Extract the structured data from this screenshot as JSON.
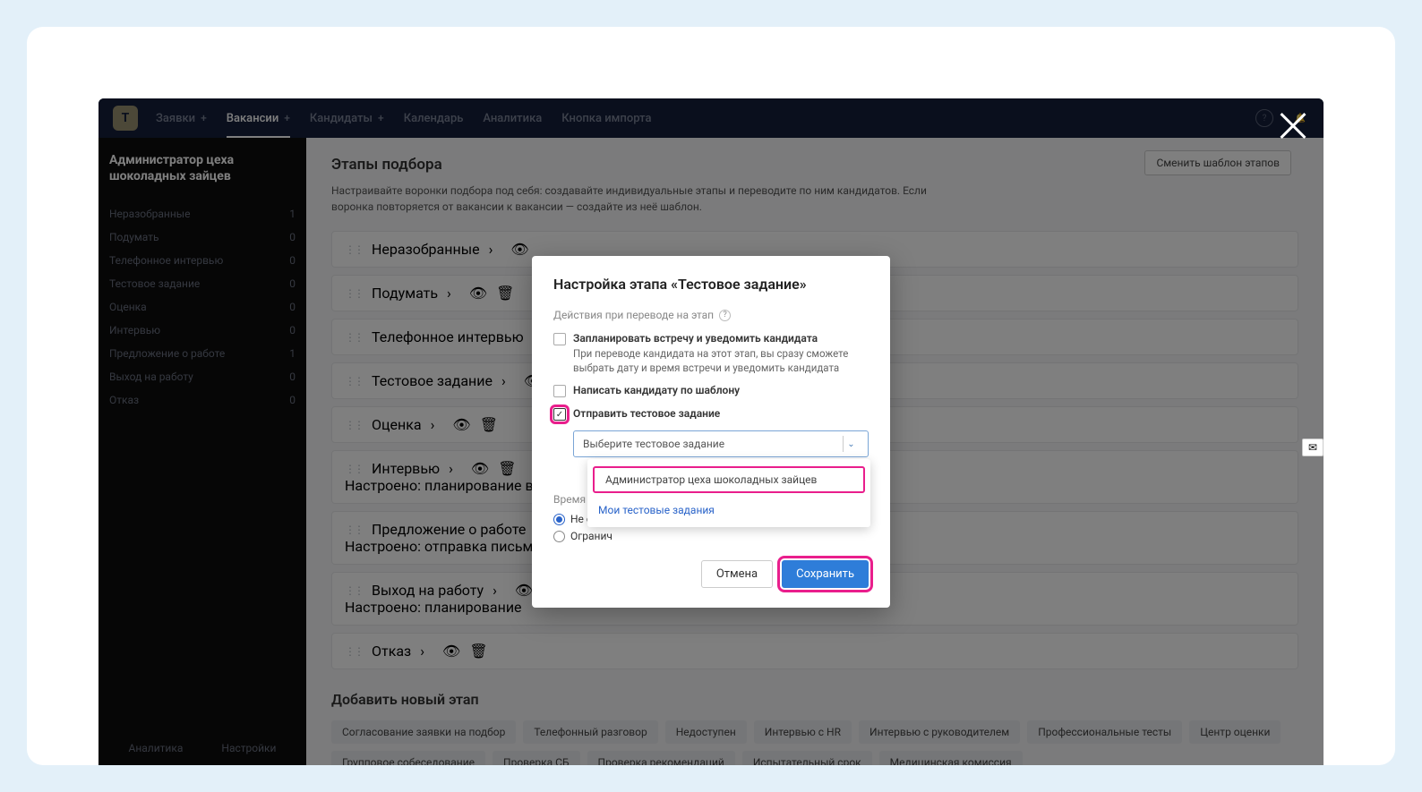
{
  "nav": {
    "items": [
      {
        "label": "Заявки",
        "plus": true
      },
      {
        "label": "Вакансии",
        "plus": true,
        "active": true
      },
      {
        "label": "Кандидаты",
        "plus": true
      },
      {
        "label": "Календарь"
      },
      {
        "label": "Аналитика"
      },
      {
        "label": "Кнопка импорта"
      }
    ]
  },
  "sidebar": {
    "title": "Администратор цеха шоколадных зайцев",
    "items": [
      {
        "label": "Неразобранные",
        "count": "1"
      },
      {
        "label": "Подумать",
        "count": "0"
      },
      {
        "label": "Телефонное интервью",
        "count": "0"
      },
      {
        "label": "Тестовое задание",
        "count": "0"
      },
      {
        "label": "Оценка",
        "count": "0"
      },
      {
        "label": "Интервью",
        "count": "0"
      },
      {
        "label": "Предложение о работе",
        "count": "1"
      },
      {
        "label": "Выход на работу",
        "count": "0"
      },
      {
        "label": "Отказ",
        "count": "0"
      }
    ],
    "footer": {
      "analytics": "Аналитика",
      "settings": "Настройки"
    }
  },
  "main": {
    "heading": "Этапы подбора",
    "desc": "Настраивайте воронки подбора под себя: создавайте индивидуальные этапы и переводите по ним кандидатов. Если воронка повторяется от вакансии к вакансии — создайте из неё шаблон.",
    "change_template": "Сменить шаблон этапов",
    "stages": [
      {
        "name": "Неразобранные",
        "sub": ""
      },
      {
        "name": "Подумать",
        "sub": ""
      },
      {
        "name": "Телефонное интервью",
        "sub": ""
      },
      {
        "name": "Тестовое задание",
        "sub": ""
      },
      {
        "name": "Оценка",
        "sub": ""
      },
      {
        "name": "Интервью",
        "sub": "Настроено: планирование в"
      },
      {
        "name": "Предложение о работе",
        "sub": "Настроено: отправка письма"
      },
      {
        "name": "Выход на работу",
        "sub": "Настроено: планирование"
      },
      {
        "name": "Отказ",
        "sub": ""
      }
    ],
    "add_stage": "Добавить новый этап",
    "chips": [
      "Согласование заявки на подбор",
      "Телефонный разговор",
      "Недоступен",
      "Интервью с HR",
      "Интервью с руководителем",
      "Профессиональные тесты",
      "Центр оценки",
      "Групповое собеседование",
      "Проверка СБ",
      "Проверка рекомендаций",
      "Испытательный срок",
      "Медицинская комиссия"
    ]
  },
  "modal": {
    "title": "Настройка этапа «Тестовое задание»",
    "actions_label": "Действия при переводе на этап",
    "cb1": {
      "title": "Запланировать встречу и уведомить кандидата",
      "desc": "При переводе кандидата на этот этап, вы сразу сможете выбрать дату и время встречи и уведомить кандидата"
    },
    "cb2": {
      "title": "Написать кандидату по шаблону"
    },
    "cb3": {
      "title": "Отправить тестовое задание"
    },
    "select_placeholder": "Выберите тестовое задание",
    "dropdown": {
      "opt1": "Администратор цеха шоколадных зайцев",
      "link": "Мои тестовые задания"
    },
    "time_label": "Время нахо",
    "radio1": "Не огра",
    "radio2": "Огранич",
    "cancel": "Отмена",
    "save": "Сохранить"
  }
}
